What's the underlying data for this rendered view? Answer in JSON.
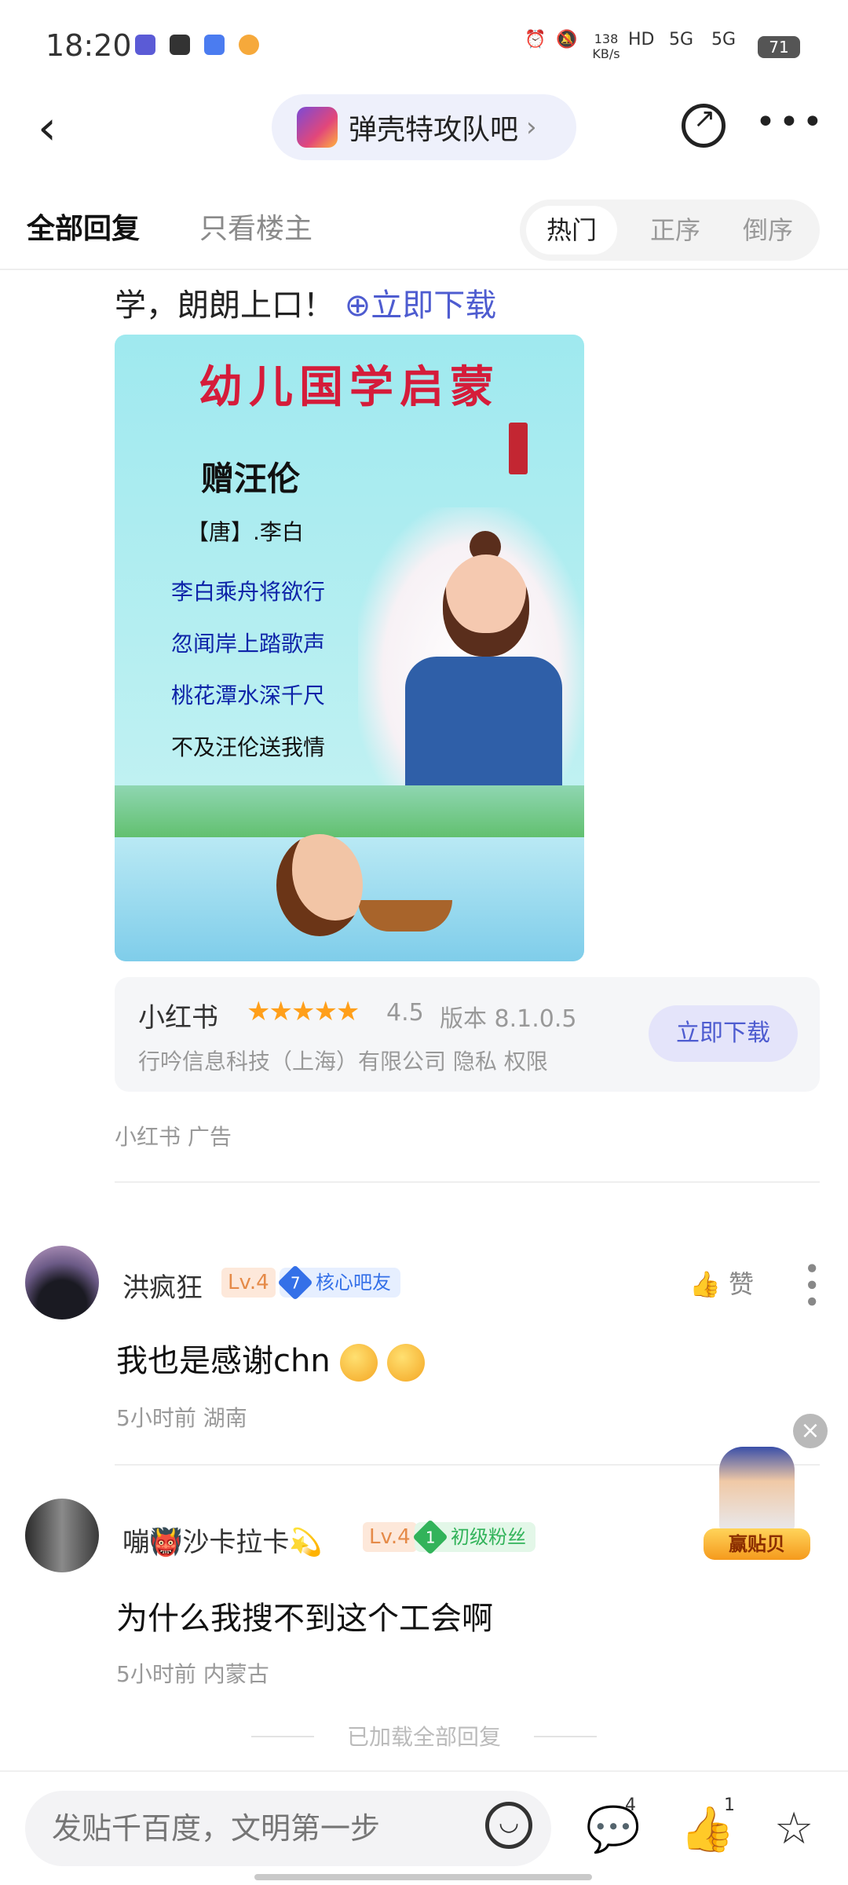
{
  "status_bar": {
    "time": "18:20",
    "network_speed": "138 KB/s",
    "signal_1": "5G",
    "signal_2": "5G",
    "hd": "HD",
    "battery": "71"
  },
  "header": {
    "forum_name": "弹壳特攻队吧",
    "forum_chevron": "›"
  },
  "tabs": {
    "all_replies": "全部回复",
    "op_only": "只看楼主",
    "sort": [
      "热门",
      "正序",
      "倒序"
    ]
  },
  "ad": {
    "text_prefix": "学，朗朗上口！",
    "download_link": "⊕立即下载",
    "image": {
      "title": "幼儿国学启蒙",
      "poem_name": "赠汪伦",
      "author": "【唐】.李白",
      "lines": [
        "李白乘舟将欲行",
        "忽闻岸上踏歌声",
        "桃花潭水深千尺",
        "不及汪伦送我情"
      ]
    },
    "app": {
      "name": "小红书",
      "stars": "★★★★★",
      "rating": "4.5",
      "version": "版本 8.1.0.5",
      "company": "行吟信息科技（上海）有限公司  隐私  权限",
      "download_button": "立即下载"
    },
    "source": "小红书  广告"
  },
  "comments": [
    {
      "username": "洪疯狂",
      "level": "Lv.4",
      "badge_num": "7",
      "badge": "核心吧友",
      "text": "我也是感谢chn",
      "time_location": "5小时前  湖南",
      "like_label": "赞"
    },
    {
      "username": "嘣👹沙卡拉卡💫",
      "level": "Lv.4",
      "badge_num": "1",
      "badge": "初级粉丝",
      "text": "为什么我搜不到这个工会啊",
      "time_location": "5小时前  内蒙古"
    }
  ],
  "promo": {
    "label": "赢贴贝"
  },
  "footer": {
    "loaded_all": "已加载全部回复",
    "input_placeholder": "发贴千百度，文明第一步",
    "comment_count": "4",
    "like_count": "1"
  },
  "colors": {
    "accent": "#4e5cd0",
    "ad_title_red": "#d51c3a",
    "star_orange": "#ff9f1a",
    "level_orange": "#e58a48",
    "badge_blue": "#3470e8",
    "badge_green": "#32b35a"
  }
}
